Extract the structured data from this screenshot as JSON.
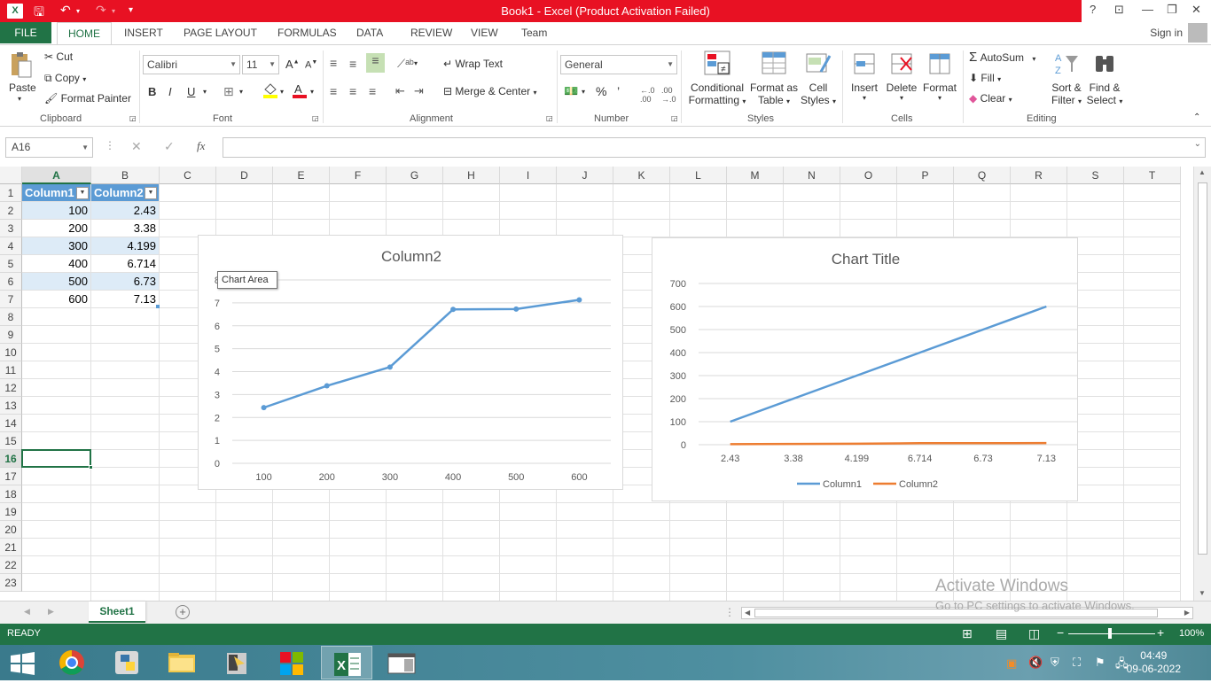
{
  "window": {
    "title": "Book1 -  Excel (Product Activation Failed)",
    "help": "?",
    "controls": [
      "⊡",
      "—",
      "❐",
      "✕"
    ]
  },
  "ribbon_tabs": [
    "FILE",
    "HOME",
    "INSERT",
    "PAGE LAYOUT",
    "FORMULAS",
    "DATA",
    "REVIEW",
    "VIEW",
    "Team"
  ],
  "signin": "Sign in",
  "clipboard": {
    "paste": "Paste",
    "cut": "Cut",
    "copy": "Copy",
    "format_painter": "Format Painter",
    "label": "Clipboard"
  },
  "font": {
    "name": "Calibri",
    "size": "11",
    "bold": "B",
    "italic": "I",
    "underline": "U",
    "label": "Font"
  },
  "alignment": {
    "wrap_text": "Wrap Text",
    "merge_center": "Merge & Center",
    "label": "Alignment"
  },
  "number": {
    "format": "General",
    "percent": "%",
    "comma": "’",
    "label": "Number"
  },
  "styles": {
    "conditional": [
      "Conditional",
      "Formatting"
    ],
    "format_table": [
      "Format as",
      "Table"
    ],
    "cell_styles": [
      "Cell",
      "Styles"
    ],
    "label": "Styles"
  },
  "cells": {
    "insert": "Insert",
    "delete": "Delete",
    "format": "Format",
    "label": "Cells"
  },
  "editing": {
    "autosum": "AutoSum",
    "fill": "Fill",
    "clear": "Clear",
    "sort": [
      "Sort &",
      "Filter"
    ],
    "find": [
      "Find &",
      "Select"
    ],
    "label": "Editing"
  },
  "formula_bar": {
    "name_box": "A16",
    "fx": "fx",
    "value": ""
  },
  "columns": [
    "A",
    "B",
    "C",
    "D",
    "E",
    "F",
    "G",
    "H",
    "I",
    "J",
    "K",
    "L",
    "M",
    "N",
    "O",
    "P",
    "Q",
    "R",
    "S",
    "T"
  ],
  "rows": [
    "1",
    "2",
    "3",
    "4",
    "5",
    "6",
    "7",
    "8",
    "9",
    "10",
    "11",
    "12",
    "13",
    "14",
    "15",
    "16",
    "17",
    "18",
    "19",
    "20",
    "21",
    "22",
    "23"
  ],
  "table": {
    "headers": [
      "Column1",
      "Column2"
    ],
    "rows": [
      [
        "100",
        "2.43"
      ],
      [
        "200",
        "3.38"
      ],
      [
        "300",
        "4.199"
      ],
      [
        "400",
        "6.714"
      ],
      [
        "500",
        "6.73"
      ],
      [
        "600",
        "7.13"
      ]
    ]
  },
  "tooltip": "Chart Area",
  "sheet_tab": "Sheet1",
  "add_sheet": "+",
  "activate_windows": {
    "title": "Activate Windows",
    "subtitle": "Go to PC settings to activate Windows."
  },
  "status": {
    "ready": "READY",
    "zoom": "100%"
  },
  "clock": {
    "time": "04:49",
    "date": "09-06-2022"
  },
  "chart_data": [
    {
      "type": "line",
      "title": "Column2",
      "categories": [
        "100",
        "200",
        "300",
        "400",
        "500",
        "600"
      ],
      "series": [
        {
          "name": "Column2",
          "values": [
            2.43,
            3.38,
            4.199,
            6.714,
            6.73,
            7.13
          ],
          "color": "#5b9bd5"
        }
      ],
      "ylim": [
        0,
        8
      ],
      "yticks": [
        "0",
        "1",
        "2",
        "3",
        "4",
        "5",
        "6",
        "7",
        "8"
      ],
      "grid": true,
      "legend": "none"
    },
    {
      "type": "line",
      "title": "Chart Title",
      "categories": [
        "2.43",
        "3.38",
        "4.199",
        "6.714",
        "6.73",
        "7.13"
      ],
      "series": [
        {
          "name": "Column1",
          "values": [
            100,
            200,
            300,
            400,
            500,
            600
          ],
          "color": "#5b9bd5"
        },
        {
          "name": "Column2",
          "values": [
            2.43,
            3.38,
            4.199,
            6.714,
            6.73,
            7.13
          ],
          "color": "#ed7d31"
        }
      ],
      "ylim": [
        0,
        700
      ],
      "yticks": [
        "0",
        "100",
        "200",
        "300",
        "400",
        "500",
        "600",
        "700"
      ],
      "grid": true,
      "legend": "bottom"
    }
  ]
}
